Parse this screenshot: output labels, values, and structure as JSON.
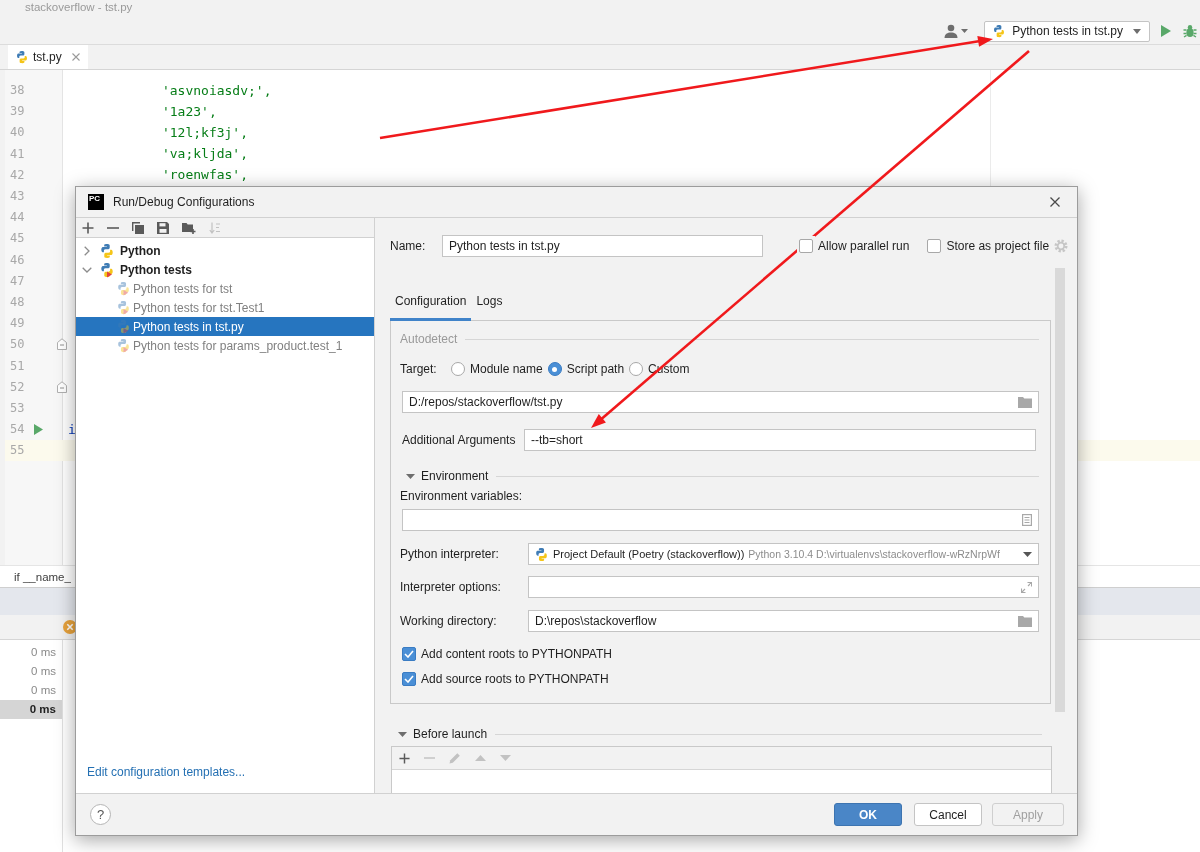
{
  "window": {
    "title": "stackoverflow - tst.py"
  },
  "toolbar": {
    "run_configuration": "Python tests in tst.py"
  },
  "editor_tabs": [
    {
      "label": "tst.py",
      "selected": true
    }
  ],
  "editor": {
    "lines": [
      {
        "number": "38",
        "code": "            'asvnoiasdv;',",
        "kind": "plain",
        "current": false
      },
      {
        "number": "39",
        "code": "            '1a23',",
        "kind": "plain",
        "current": false
      },
      {
        "number": "40",
        "code": "            '12l;kf3j',",
        "kind": "plain",
        "current": false
      },
      {
        "number": "41",
        "code": "            'va;kljda',",
        "kind": "plain",
        "current": false
      },
      {
        "number": "42",
        "code": "            'roenwfas',",
        "kind": "plain",
        "current": false
      },
      {
        "number": "43",
        "kind": "plain",
        "current": false
      },
      {
        "number": "44",
        "kind": "plain",
        "current": false
      },
      {
        "number": "45",
        "kind": "plain",
        "current": false
      },
      {
        "number": "46",
        "kind": "plain",
        "current": false
      },
      {
        "number": "47",
        "kind": "plain",
        "current": false
      },
      {
        "number": "48",
        "kind": "plain",
        "current": false
      },
      {
        "number": "49",
        "kind": "plain",
        "current": false
      },
      {
        "number": "50",
        "kind": "fold",
        "current": false
      },
      {
        "number": "51",
        "kind": "plain",
        "current": false
      },
      {
        "number": "52",
        "kind": "fold",
        "current": false
      },
      {
        "number": "53",
        "kind": "plain",
        "current": false
      },
      {
        "number": "54",
        "code": "i",
        "kind": "run",
        "current": false
      },
      {
        "number": "55",
        "kind": "plain",
        "current": true
      }
    ],
    "breadcrumb": "if __name_"
  },
  "test_panel": {
    "durations": [
      {
        "text": "0 ms",
        "selected": false
      },
      {
        "text": "0 ms",
        "selected": false
      },
      {
        "text": "0 ms",
        "selected": false
      },
      {
        "text": "0 ms",
        "selected": true
      }
    ]
  },
  "dialog": {
    "logo": "PC",
    "title": "Run/Debug Configurations",
    "tools": [
      {
        "kind": "add",
        "disabled": false
      },
      {
        "kind": "remove",
        "disabled": false
      },
      {
        "kind": "copy",
        "disabled": false
      },
      {
        "kind": "save",
        "disabled": false
      },
      {
        "kind": "folder",
        "disabled": false
      },
      {
        "kind": "sort",
        "disabled": true
      }
    ],
    "tree": [
      {
        "label": "Python",
        "kind": "python",
        "expanded": false,
        "selected": false,
        "temporary": false
      },
      {
        "label": "Python tests",
        "kind": "tests",
        "expanded": true,
        "selected": false,
        "temporary": false,
        "children": [
          {
            "label": "Python tests for tst",
            "selected": false,
            "temporary": true
          },
          {
            "label": "Python tests for tst.Test1",
            "selected": false,
            "temporary": true
          },
          {
            "label": "Python tests in tst.py",
            "selected": true,
            "temporary": true
          },
          {
            "label": "Python tests for params_product.test_1",
            "selected": false,
            "temporary": true
          }
        ]
      }
    ],
    "templates_link": "Edit configuration templates...",
    "form": {
      "name": {
        "label": "Name:",
        "value": "Python tests in tst.py"
      },
      "options": [
        {
          "label": "Allow parallel run",
          "checked": false
        },
        {
          "label": "Store as project file",
          "checked": false
        }
      ],
      "tabs": [
        {
          "label": "Configuration",
          "selected": true
        },
        {
          "label": "Logs",
          "selected": false
        }
      ],
      "autodetect": {
        "title": "Autodetect",
        "target_label": "Target:",
        "target_options": [
          {
            "label": "Module name",
            "selected": false
          },
          {
            "label": "Script path",
            "selected": true
          },
          {
            "label": "Custom",
            "selected": false
          }
        ],
        "script_path": "D:/repos/stackoverflow/tst.py",
        "arguments": {
          "label": "Additional Arguments",
          "value": "--tb=short"
        }
      },
      "environment": {
        "title": "Environment",
        "expanded": true,
        "variables_label": "Environment variables:",
        "interpreter": {
          "label": "Python interpreter:",
          "value": "Project Default (Poetry (stackoverflow))",
          "detail": "Python 3.10.4 D:\\virtualenvs\\stackoverflow-wRzNrpWf"
        },
        "interpreter_options_label": "Interpreter options:",
        "working_directory": {
          "label": "Working directory:",
          "value": "D:\\repos\\stackoverflow"
        },
        "checkboxes": [
          {
            "label": "Add content roots to PYTHONPATH",
            "checked": true
          },
          {
            "label": "Add source roots to PYTHONPATH",
            "checked": true
          }
        ]
      },
      "before_launch": {
        "title": "Before launch",
        "expanded": true,
        "tools": [
          {
            "kind": "add",
            "disabled": false
          },
          {
            "kind": "remove",
            "disabled": true
          },
          {
            "kind": "edit",
            "disabled": true
          },
          {
            "kind": "up",
            "disabled": true
          },
          {
            "kind": "down",
            "disabled": true
          }
        ]
      }
    },
    "help": "?",
    "buttons": [
      {
        "label": "OK",
        "kind": "default",
        "disabled": false
      },
      {
        "label": "Cancel",
        "kind": "normal",
        "disabled": false
      },
      {
        "label": "Apply",
        "kind": "normal",
        "disabled": true
      }
    ]
  },
  "annotation_arrows": [
    {
      "kind": "arrow"
    },
    {
      "kind": "arrow"
    }
  ]
}
